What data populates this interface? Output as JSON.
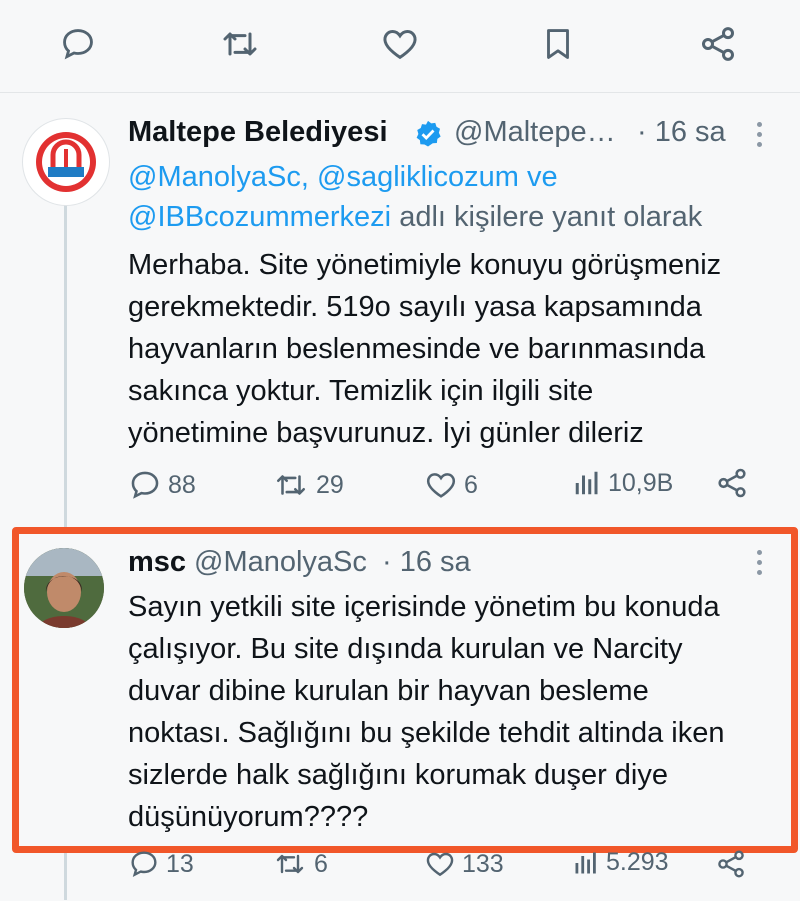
{
  "tweet1": {
    "display_name": "Maltepe Belediyesi",
    "handle": "@Maltepe…",
    "time": "· 16 sa",
    "reply_links": [
      "@ManolyaSc, @sagliklicozum ve",
      "@IBBcozummerkezi"
    ],
    "reply_suffix": "adlı kişilere yanıt olarak",
    "text_lines": [
      "Merhaba. Site yönetimiyle konuyu görüşmeniz",
      "gerekmektedir. 519o sayılı yasa kapsamında",
      "hayvanların beslenmesinde ve barınmasında",
      "sakınca yoktur. Temizlik için ilgili site",
      "yönetimine başvurunuz. İyi günler dileriz"
    ],
    "stats": {
      "replies": "88",
      "retweets": "29",
      "likes": "6",
      "views": "10,9B"
    }
  },
  "tweet2": {
    "display_name": "msc",
    "handle": "@ManolyaSc",
    "time": "· 16 sa",
    "text_lines": [
      "Sayın yetkili site içerisinde yönetim bu konuda",
      "çalışıyor. Bu site dışında kurulan ve Narcity",
      "duvar dibine kurulan bir hayvan besleme",
      "noktası. Sağlığını bu şekilde tehdit altinda iken",
      "sizlerde halk sağlığını korumak duşer  diye",
      "düşünüyorum????"
    ],
    "stats": {
      "replies": "13",
      "retweets": "6",
      "likes": "133",
      "views": "5.293"
    }
  },
  "icons": [
    "reply-icon",
    "retweet-icon",
    "like-icon",
    "bookmark-icon",
    "share-icon",
    "verified-icon",
    "views-icon",
    "more-icon"
  ],
  "colors": {
    "link": "#1d9bf0",
    "highlight_border": "#f1572a",
    "muted": "#536471"
  }
}
